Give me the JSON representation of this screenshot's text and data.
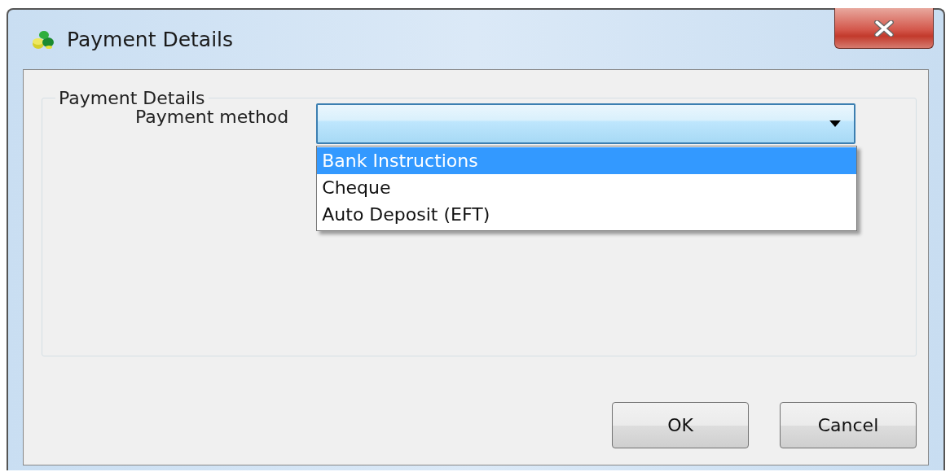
{
  "window": {
    "title": "Payment Details"
  },
  "group": {
    "title": "Payment Details"
  },
  "field": {
    "label": "Payment method",
    "expanded": true
  },
  "options": [
    {
      "label": "Bank Instructions",
      "selected": true
    },
    {
      "label": "Cheque",
      "selected": false
    },
    {
      "label": "Auto Deposit (EFT)",
      "selected": false
    }
  ],
  "buttons": [
    "OK",
    "Cancel"
  ]
}
